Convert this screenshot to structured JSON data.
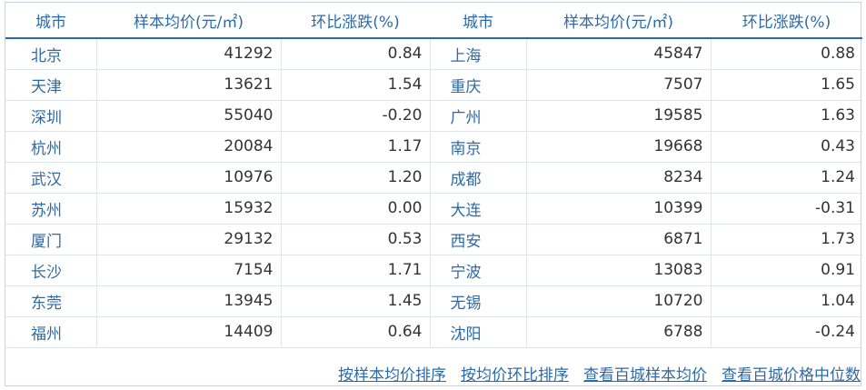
{
  "headers": {
    "city": "城市",
    "avg_price": "样本均价(元/㎡)",
    "change": "环比涨跌(%)"
  },
  "rows": [
    {
      "left": {
        "city": "北京",
        "price": "41292",
        "change": "0.84"
      },
      "right": {
        "city": "上海",
        "price": "45847",
        "change": "0.88"
      }
    },
    {
      "left": {
        "city": "天津",
        "price": "13621",
        "change": "1.54"
      },
      "right": {
        "city": "重庆",
        "price": "7507",
        "change": "1.65"
      }
    },
    {
      "left": {
        "city": "深圳",
        "price": "55040",
        "change": "-0.20"
      },
      "right": {
        "city": "广州",
        "price": "19585",
        "change": "1.63"
      }
    },
    {
      "left": {
        "city": "杭州",
        "price": "20084",
        "change": "1.17"
      },
      "right": {
        "city": "南京",
        "price": "19668",
        "change": "0.43"
      }
    },
    {
      "left": {
        "city": "武汉",
        "price": "10976",
        "change": "1.20"
      },
      "right": {
        "city": "成都",
        "price": "8234",
        "change": "1.24"
      }
    },
    {
      "left": {
        "city": "苏州",
        "price": "15932",
        "change": "0.00"
      },
      "right": {
        "city": "大连",
        "price": "10399",
        "change": "-0.31"
      }
    },
    {
      "left": {
        "city": "厦门",
        "price": "29132",
        "change": "0.53"
      },
      "right": {
        "city": "西安",
        "price": "6871",
        "change": "1.73"
      }
    },
    {
      "left": {
        "city": "长沙",
        "price": "7154",
        "change": "1.71"
      },
      "right": {
        "city": "宁波",
        "price": "13083",
        "change": "0.91"
      }
    },
    {
      "left": {
        "city": "东莞",
        "price": "13945",
        "change": "1.45"
      },
      "right": {
        "city": "无锡",
        "price": "10720",
        "change": "1.04"
      }
    },
    {
      "left": {
        "city": "福州",
        "price": "14409",
        "change": "0.64"
      },
      "right": {
        "city": "沈阳",
        "price": "6788",
        "change": "-0.24"
      }
    }
  ],
  "links": {
    "sort_by_price": "按样本均价排序",
    "sort_by_change": "按均价环比排序",
    "view_100_avg": "查看百城样本均价",
    "view_100_median": "查看百城价格中位数"
  },
  "colors": {
    "link_blue": "#2d6aa8",
    "header_rule": "#2f6aa6",
    "grid_line": "#dfe5ec",
    "panel_border": "#c8d2de"
  }
}
